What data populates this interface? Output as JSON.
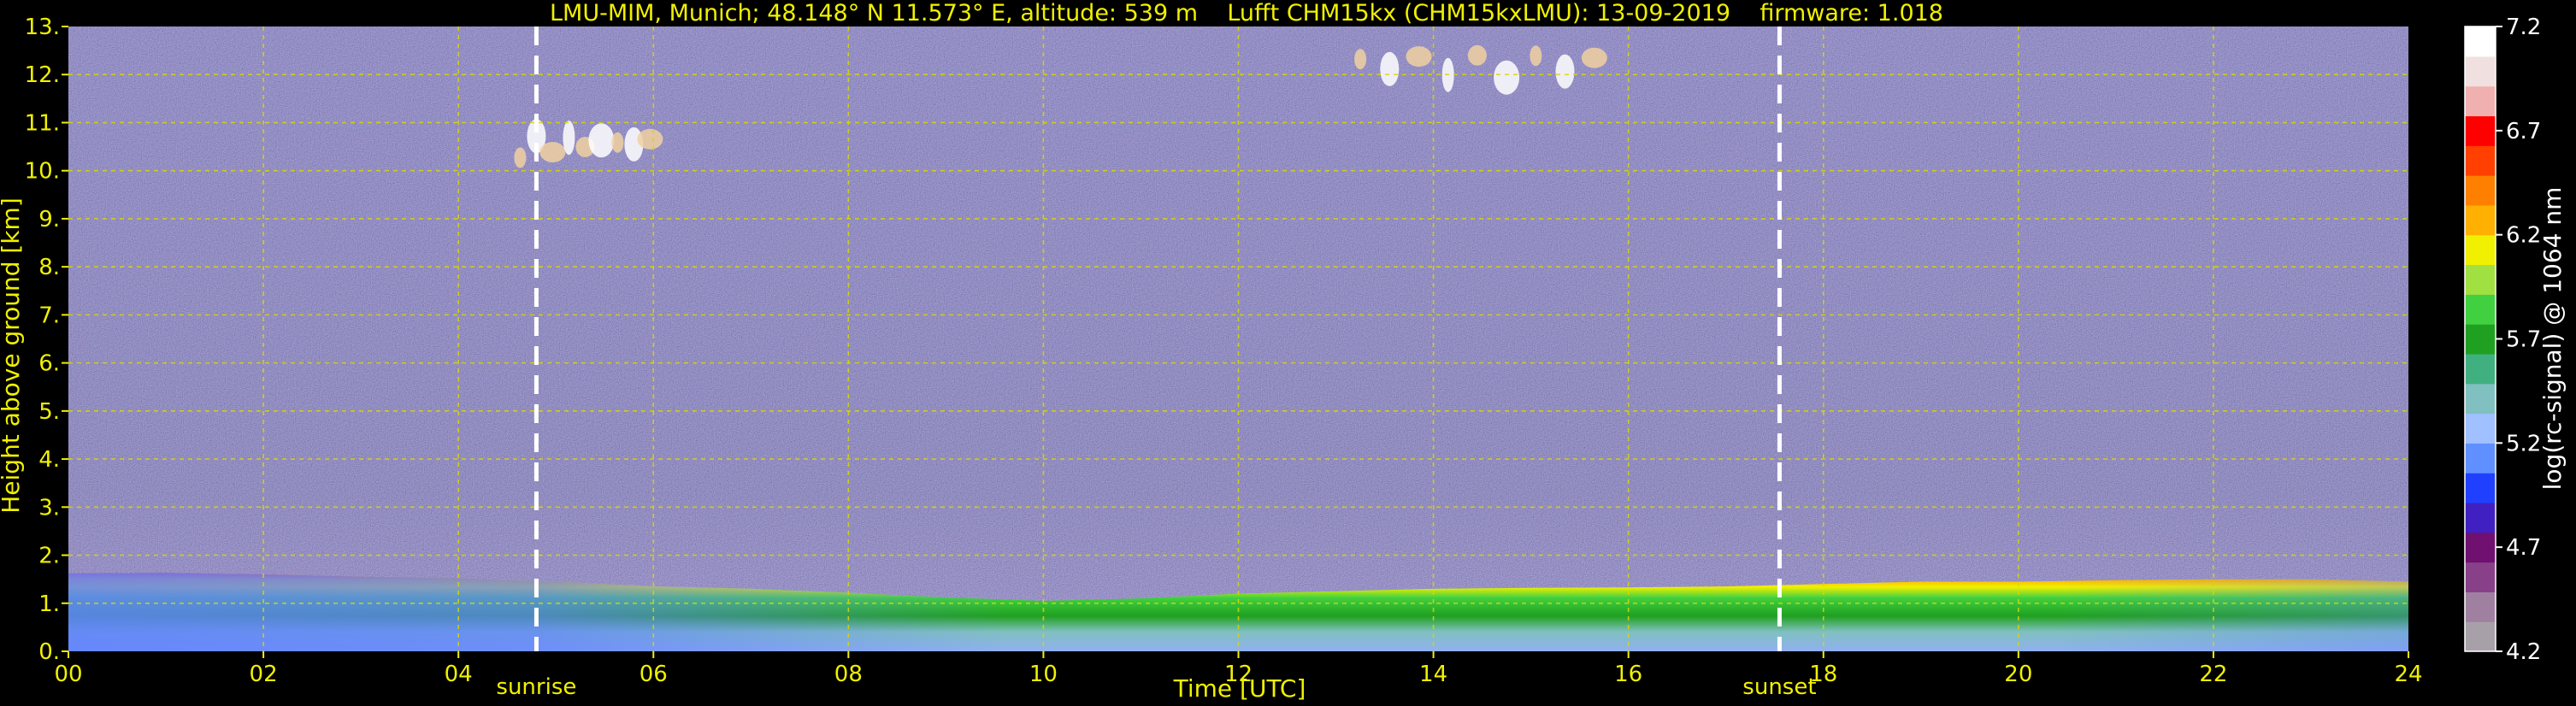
{
  "chart_data": {
    "type": "heatmap",
    "title": "LMU-MIM, Munich; 48.148° N 11.573° E, altitude: 539 m    Lufft CHM15kx (CHM15kxLMU): 13-09-2019    firmware: 1.018",
    "xlabel": "Time [UTC]",
    "ylabel": "Height above ground [km]",
    "xlim": [
      0,
      24
    ],
    "ylim": [
      0,
      13
    ],
    "x_ticks": [
      "00",
      "02",
      "04",
      "06",
      "08",
      "10",
      "12",
      "14",
      "16",
      "18",
      "20",
      "22",
      "24"
    ],
    "y_ticks": [
      "0.",
      "1.",
      "2.",
      "3.",
      "4.",
      "5.",
      "6.",
      "7.",
      "8.",
      "9.",
      "10.",
      "11.",
      "12.",
      "13."
    ],
    "grid": true,
    "events": [
      {
        "label": "sunrise",
        "x": 4.8
      },
      {
        "label": "sunset",
        "x": 17.55
      }
    ],
    "boundary_layer_top_km": [
      [
        0,
        1.62
      ],
      [
        1,
        1.63
      ],
      [
        2,
        1.6
      ],
      [
        3,
        1.55
      ],
      [
        4,
        1.52
      ],
      [
        5,
        1.45
      ],
      [
        6,
        1.35
      ],
      [
        7,
        1.3
      ],
      [
        8,
        1.22
      ],
      [
        9,
        1.12
      ],
      [
        10,
        1.05
      ],
      [
        11,
        1.1
      ],
      [
        12,
        1.2
      ],
      [
        13,
        1.25
      ],
      [
        14,
        1.3
      ],
      [
        15,
        1.32
      ],
      [
        16,
        1.33
      ],
      [
        17,
        1.35
      ],
      [
        18,
        1.4
      ],
      [
        19,
        1.45
      ],
      [
        20,
        1.45
      ],
      [
        21,
        1.48
      ],
      [
        22,
        1.5
      ],
      [
        23,
        1.5
      ],
      [
        24,
        1.45
      ]
    ],
    "cloud_features": [
      {
        "x": [
          4.55,
          6.05
        ],
        "y": [
          10.0,
          10.9
        ]
      },
      {
        "x": [
          13.1,
          15.8
        ],
        "y": [
          11.6,
          12.6
        ]
      }
    ],
    "colorbar": {
      "label": "log(rc-signal) @ 1064 nm",
      "range": [
        4.2,
        7.2
      ],
      "ticks": [
        "4.2",
        "4.7",
        "5.2",
        "5.7",
        "6.2",
        "6.7",
        "7.2"
      ],
      "colors": [
        "#a8a0a8",
        "#a080a0",
        "#884088",
        "#701070",
        "#4020c0",
        "#2040ff",
        "#6090ff",
        "#a0c0ff",
        "#80c0c0",
        "#40b080",
        "#20a020",
        "#40d040",
        "#a0e040",
        "#f0f000",
        "#ffb000",
        "#ff8000",
        "#ff4000",
        "#ff0000",
        "#f0b0b0",
        "#f0e0e0",
        "#ffffff"
      ]
    }
  }
}
